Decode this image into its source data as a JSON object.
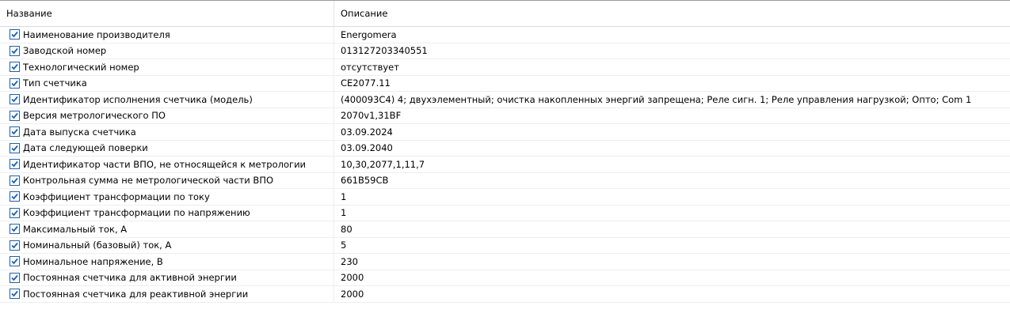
{
  "header": {
    "name": "Название",
    "description": "Описание"
  },
  "rows": [
    {
      "name": "Наименование производителя",
      "value": "Energomera",
      "checked": true
    },
    {
      "name": "Заводской номер",
      "value": "013127203340551",
      "checked": true
    },
    {
      "name": "Технологический номер",
      "value": "отсутствует",
      "checked": true
    },
    {
      "name": "Тип счетчика",
      "value": "CE2077.11",
      "checked": true
    },
    {
      "name": "Идентификатор исполнения счетчика (модель)",
      "value": "(400093C4) 4; двухэлементный; очистка накопленных энергий запрещена; Реле сигн. 1; Реле управления нагрузкой; Опто; Com 1",
      "checked": true
    },
    {
      "name": "Версия метрологического ПО",
      "value": "2070v1,31BF",
      "checked": true
    },
    {
      "name": "Дата выпуска счетчика",
      "value": "03.09.2024",
      "checked": true
    },
    {
      "name": "Дата следующей поверки",
      "value": "03.09.2040",
      "checked": true
    },
    {
      "name": "Идентификатор части ВПО, не относящейся к метрологии",
      "value": "10,30,2077,1,11,7",
      "checked": true
    },
    {
      "name": "Контрольная сумма не метрологической части ВПО",
      "value": "661B59CB",
      "checked": true
    },
    {
      "name": "Коэффициент трансформации по току",
      "value": "1",
      "checked": true
    },
    {
      "name": "Коэффициент трансформации по напряжению",
      "value": "1",
      "checked": true
    },
    {
      "name": "Максимальный ток, А",
      "value": "80",
      "checked": true
    },
    {
      "name": "Номинальный (базовый) ток, А",
      "value": "5",
      "checked": true
    },
    {
      "name": "Номинальное напряжение, В",
      "value": "230",
      "checked": true
    },
    {
      "name": "Постоянная счетчика для активной энергии",
      "value": "2000",
      "checked": true
    },
    {
      "name": "Постоянная счетчика для реактивной энергии",
      "value": "2000",
      "checked": true
    }
  ]
}
